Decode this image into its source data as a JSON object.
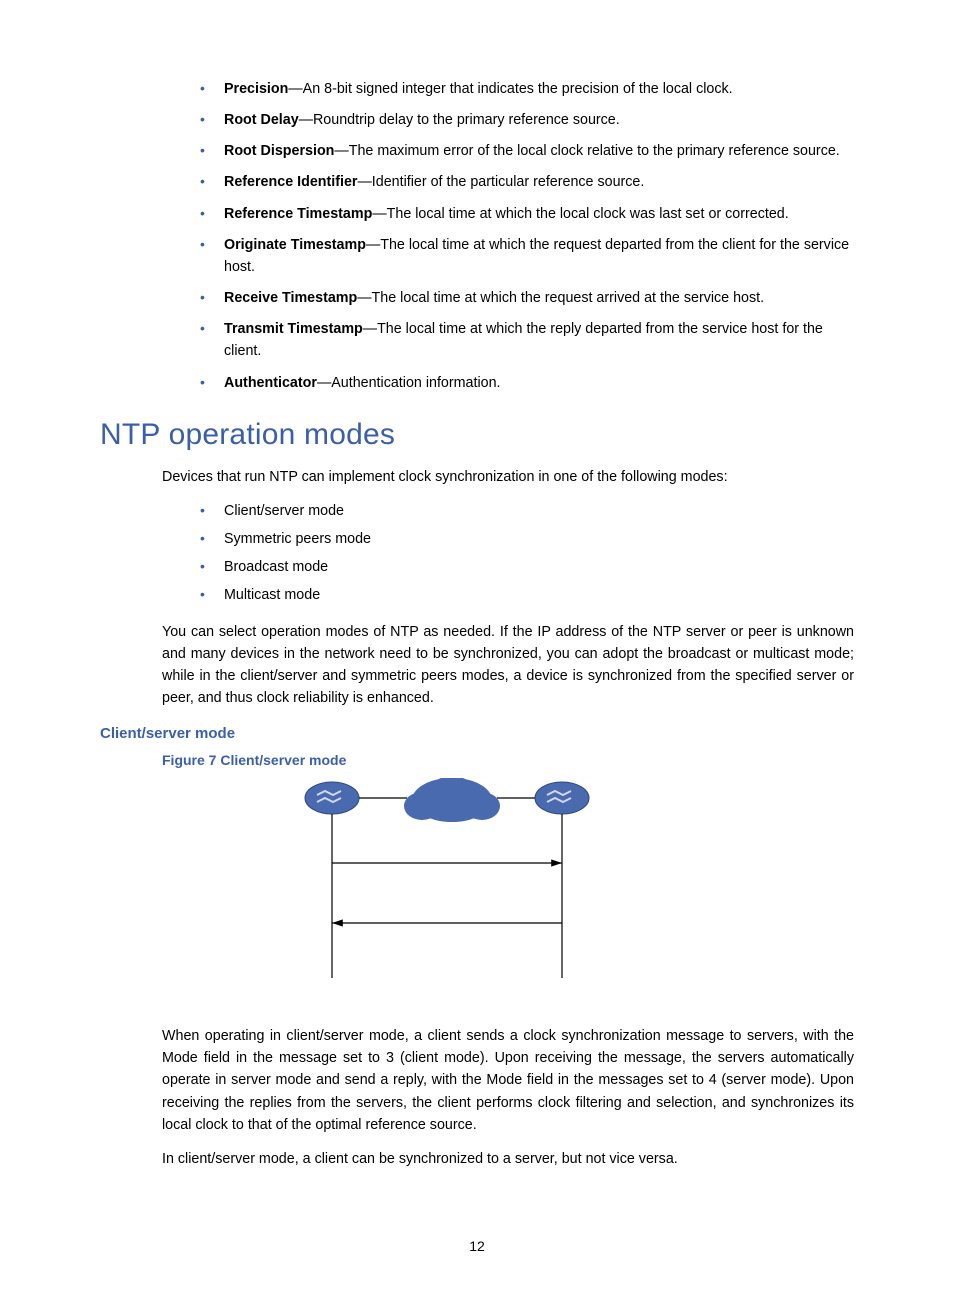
{
  "fields": [
    {
      "term": "Precision",
      "desc": "—An 8-bit signed integer that indicates the precision of the local clock."
    },
    {
      "term": "Root Delay",
      "desc": "—Roundtrip delay to the primary reference source."
    },
    {
      "term": "Root Dispersion",
      "desc": "—The maximum error of the local clock relative to the primary reference source."
    },
    {
      "term": "Reference Identifier",
      "desc": "—Identifier of the particular reference source."
    },
    {
      "term": "Reference Timestamp",
      "desc": "—The local time at which the local clock was last set or corrected."
    },
    {
      "term": "Originate Timestamp",
      "desc": "—The local time at which the request departed from the client for the service host."
    },
    {
      "term": "Receive Timestamp",
      "desc": "—The local time at which the request arrived at the service host."
    },
    {
      "term": "Transmit Timestamp",
      "desc": "—The local time at which the reply departed from the service host for the client."
    },
    {
      "term": "Authenticator",
      "desc": "—Authentication information."
    }
  ],
  "heading": "NTP operation modes",
  "intro": "Devices that run NTP can implement clock synchronization in one of the following modes:",
  "modes": [
    "Client/server mode",
    "Symmetric peers mode",
    "Broadcast mode",
    "Multicast mode"
  ],
  "modes_note": "You can select operation modes of NTP as needed. If the IP address of the NTP server or peer is unknown and many devices in the network need to be synchronized, you can adopt the broadcast or multicast mode; while in the client/server and symmetric peers modes, a device is synchronized from the specified server or peer, and thus clock reliability is enhanced.",
  "sub_heading": "Client/server mode",
  "figure_caption": "Figure 7 Client/server mode",
  "cs_para1": "When operating in client/server mode, a client sends a clock synchronization message to servers, with the Mode field in the message set to 3 (client mode). Upon receiving the message, the servers automatically operate in server mode and send a reply, with the Mode field in the messages set to 4 (server mode). Upon receiving the replies from the servers, the client performs clock filtering and selection, and synchronizes its local clock to that of the optimal reference source.",
  "cs_para2": "In client/server mode, a client can be synchronized to a server, but not vice versa.",
  "page_number": "12"
}
